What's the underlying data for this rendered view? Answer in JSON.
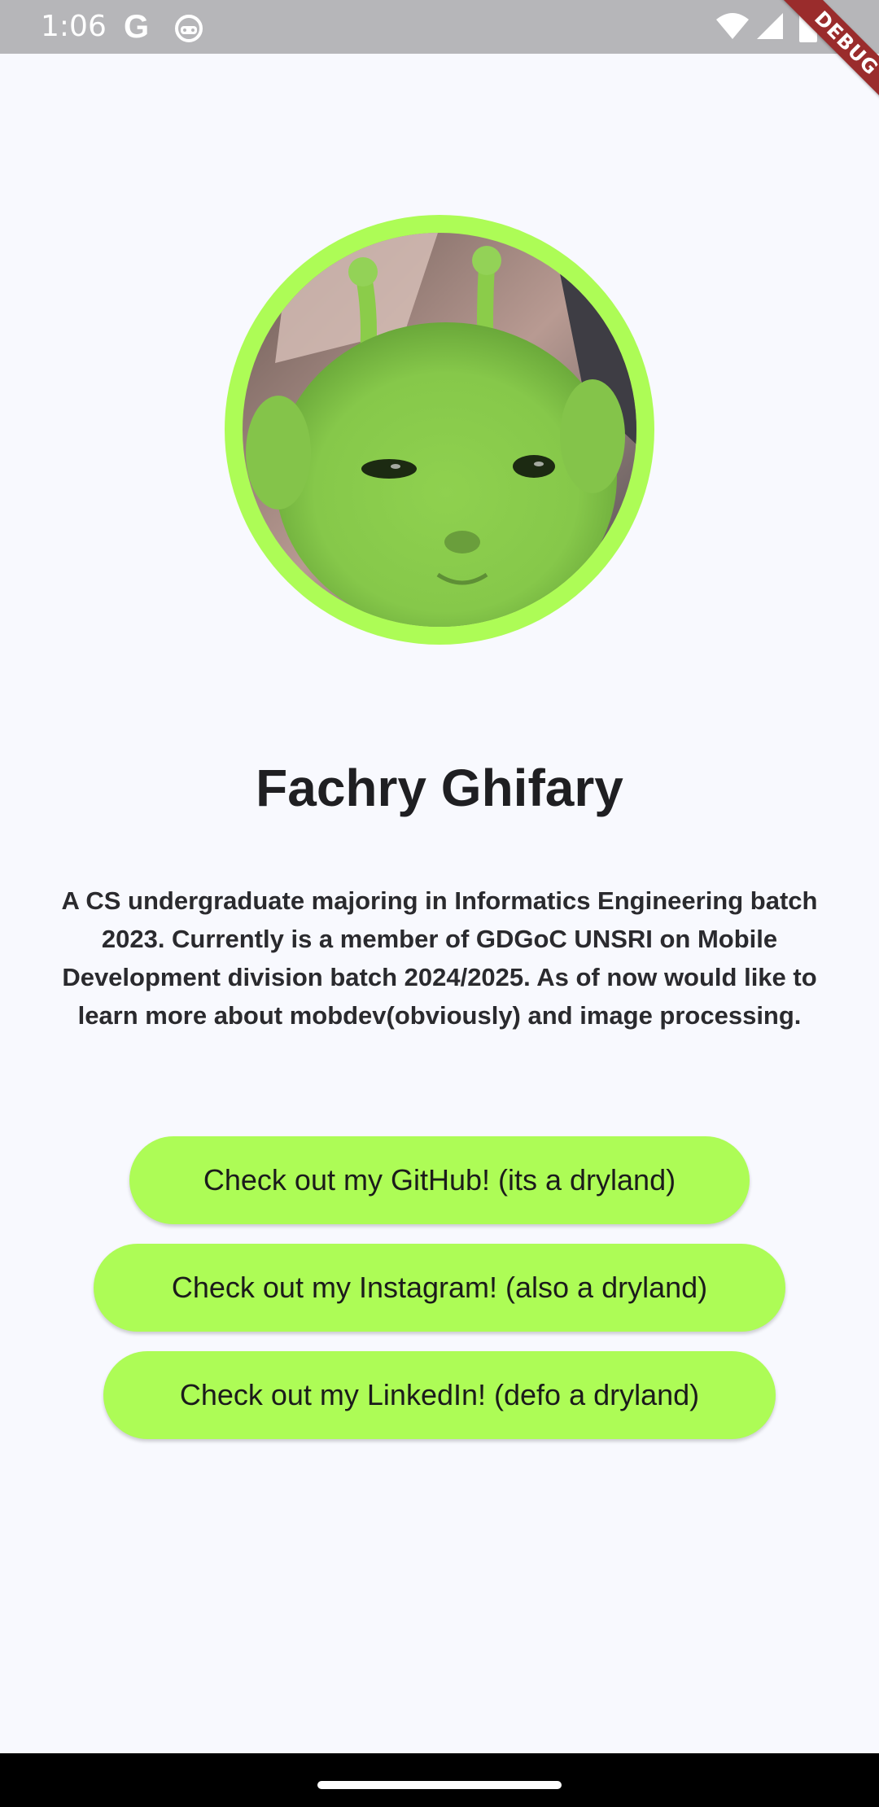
{
  "status_bar": {
    "time": "1:06",
    "google_glyph": "G",
    "icons": [
      "google-icon",
      "robot-icon",
      "wifi-icon",
      "signal-icon",
      "battery-icon"
    ]
  },
  "debug_banner": {
    "label": "DEBUG"
  },
  "profile": {
    "name": "Fachry Ghifary",
    "bio": "A CS undergraduate majoring in Informatics Engineering batch 2023. Currently is a member of GDGoC UNSRI on Mobile Development division batch 2024/2025. As of now would like to learn more about mobdev(obviously) and image processing."
  },
  "buttons": {
    "github": "Check out my GitHub! (its a dryland)",
    "instagram": "Check out my Instagram! (also a dryland)",
    "linkedin": "Check out my LinkedIn! (defo a dryland)"
  },
  "colors": {
    "accent": "#adfc56",
    "background": "#f8f9fe",
    "status_bar": "#b6b6b9",
    "debug_banner": "#9a2c2c",
    "text": "#1f1f22"
  }
}
